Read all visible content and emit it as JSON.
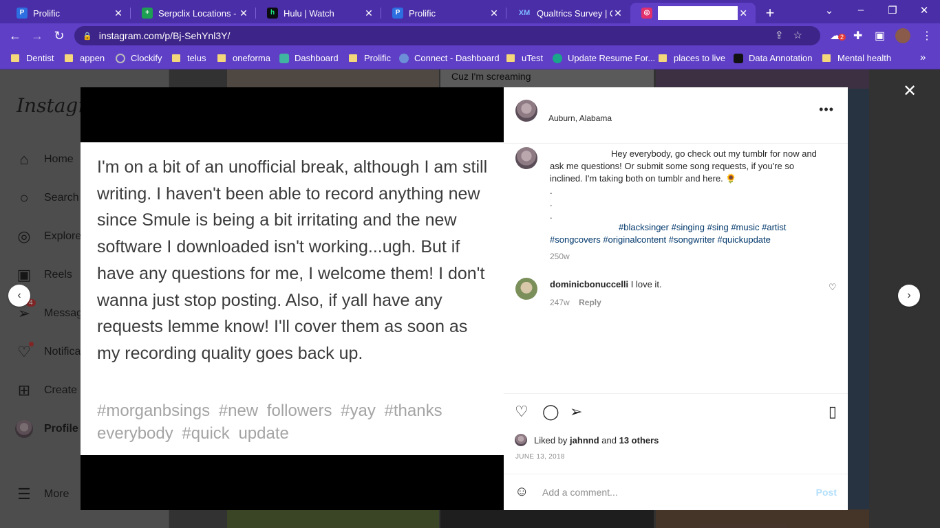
{
  "browser": {
    "tabs": [
      {
        "label": "Prolific",
        "icon": "prolific-icon"
      },
      {
        "label": "Serpclix Locations - Go",
        "icon": "sheets-icon"
      },
      {
        "label": "Hulu | Watch",
        "icon": "hulu-icon"
      },
      {
        "label": "Prolific",
        "icon": "prolific-icon"
      },
      {
        "label": "Qualtrics Survey | Qua",
        "icon": "qualtrics-icon"
      },
      {
        "label": "",
        "icon": "instagram-icon"
      }
    ],
    "url": "instagram.com/p/Bj-SehYnl3Y/",
    "ext_badge": "2",
    "bookmarks": [
      "Dentist",
      "appen",
      "Clockify",
      "telus",
      "oneforma",
      "Dashboard",
      "Prolific",
      "Connect - Dashboard",
      "uTest",
      "Update Resume For...",
      "places to live",
      "Data Annotation",
      "Mental health"
    ]
  },
  "sidebar": {
    "logo": "Instagram",
    "items": [
      "Home",
      "Search",
      "Explore",
      "Reels",
      "Messages",
      "Notifications",
      "Create",
      "Profile",
      "More"
    ],
    "messages_badge": "4"
  },
  "background_snippet": "Cuz I'm screaming",
  "post": {
    "image_text": "I'm on a bit of an unofficial break, although I am still writing. I haven't been able to record anything new since Smule is being a bit irritating and the new software I downloaded isn't working...ugh. But if have any questions for me, I welcome them! I don't wanna just stop posting. Also, if yall have any requests lemme know! I'll cover them as soon as my recording quality goes back up.",
    "image_tags": "#morganbsings #new followers #yay #thanks everybody #quick update",
    "location": "Auburn, Alabama",
    "caption": "Hey everybody, go check out my tumblr for now and ask me questions! Or submit some song requests, if you're so inclined. I'm taking both on tumblr and here. 🌻",
    "caption_dots": [
      ".",
      ".",
      "."
    ],
    "caption_tags": "#blacksinger #singing #sing #music #artist #songcovers #originalcontent #songwriter #quickupdate",
    "caption_age": "250w",
    "comment": {
      "user": "dominicbonuccelli",
      "text": "I love it.",
      "age": "247w",
      "reply": "Reply"
    },
    "liked_by_prefix": "Liked by",
    "liked_user": "jahnnd",
    "liked_and": "and",
    "liked_others": "13 others",
    "date": "JUNE 13, 2018",
    "comment_placeholder": "Add a comment...",
    "post_button": "Post"
  },
  "colors": {
    "brand": "#5e3fc6",
    "tabbar": "#4a2ea8",
    "link": "#00376b"
  }
}
